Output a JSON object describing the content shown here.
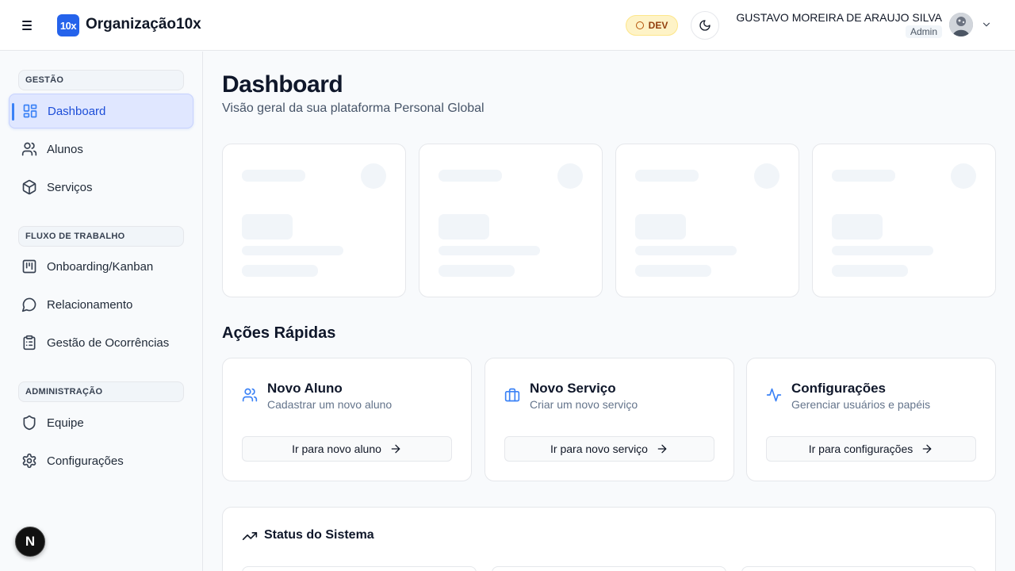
{
  "header": {
    "logo_text": "10x",
    "brand": "Organização10x",
    "env_badge": "DEV",
    "user_name": "GUSTAVO MOREIRA DE ARAUJO SILVA",
    "user_role": "Admin"
  },
  "sidebar": {
    "sections": [
      {
        "label": "GESTÃO"
      },
      {
        "label": "FLUXO DE TRABALHO"
      },
      {
        "label": "ADMINISTRAÇÃO"
      }
    ],
    "items": [
      {
        "label": "Dashboard",
        "icon": "layout-dashboard-icon",
        "active": true
      },
      {
        "label": "Alunos",
        "icon": "users-icon"
      },
      {
        "label": "Serviços",
        "icon": "package-icon"
      },
      {
        "label": "Onboarding/Kanban",
        "icon": "kanban-icon"
      },
      {
        "label": "Relacionamento",
        "icon": "message-circle-icon"
      },
      {
        "label": "Gestão de Ocorrências",
        "icon": "clipboard-list-icon"
      },
      {
        "label": "Equipe",
        "icon": "shield-icon"
      },
      {
        "label": "Configurações",
        "icon": "settings-icon"
      }
    ],
    "footer_badge": "N"
  },
  "main": {
    "title": "Dashboard",
    "subtitle": "Visão geral da sua plataforma Personal Global",
    "quick_actions_title": "Ações Rápidas",
    "quick_actions": [
      {
        "title": "Novo Aluno",
        "description": "Cadastrar um novo aluno",
        "button": "Ir para novo aluno",
        "icon": "users-icon"
      },
      {
        "title": "Novo Serviço",
        "description": "Criar um novo serviço",
        "button": "Ir para novo serviço",
        "icon": "briefcase-icon"
      },
      {
        "title": "Configurações",
        "description": "Gerenciar usuários e papéis",
        "button": "Ir para configurações",
        "icon": "activity-icon"
      }
    ],
    "status_title": "Status do Sistema"
  },
  "colors": {
    "accent": "#2563eb",
    "active_bg": "#e0e7ff",
    "dev_badge_bg": "#fef3c7"
  }
}
